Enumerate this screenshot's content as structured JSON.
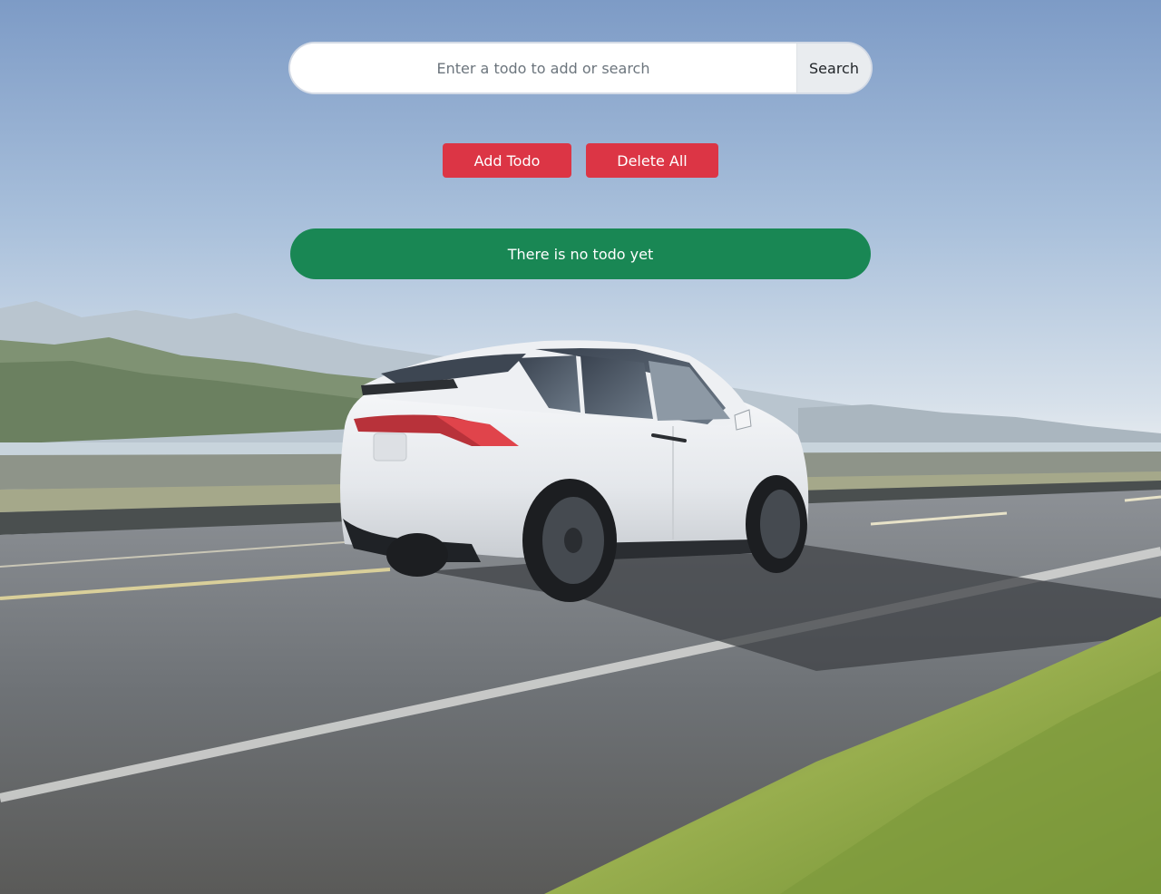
{
  "search": {
    "placeholder": "Enter a todo to add or search",
    "value": "",
    "button_label": "Search"
  },
  "actions": {
    "add_label": "Add Todo",
    "delete_all_label": "Delete All"
  },
  "todos": {
    "empty_message": "There is no todo yet",
    "items": []
  },
  "colors": {
    "danger": "#dc3545",
    "success": "#198754",
    "search_button_bg": "#e9ecef"
  },
  "background": {
    "image_subject": "white-suv-driving-on-highway"
  }
}
